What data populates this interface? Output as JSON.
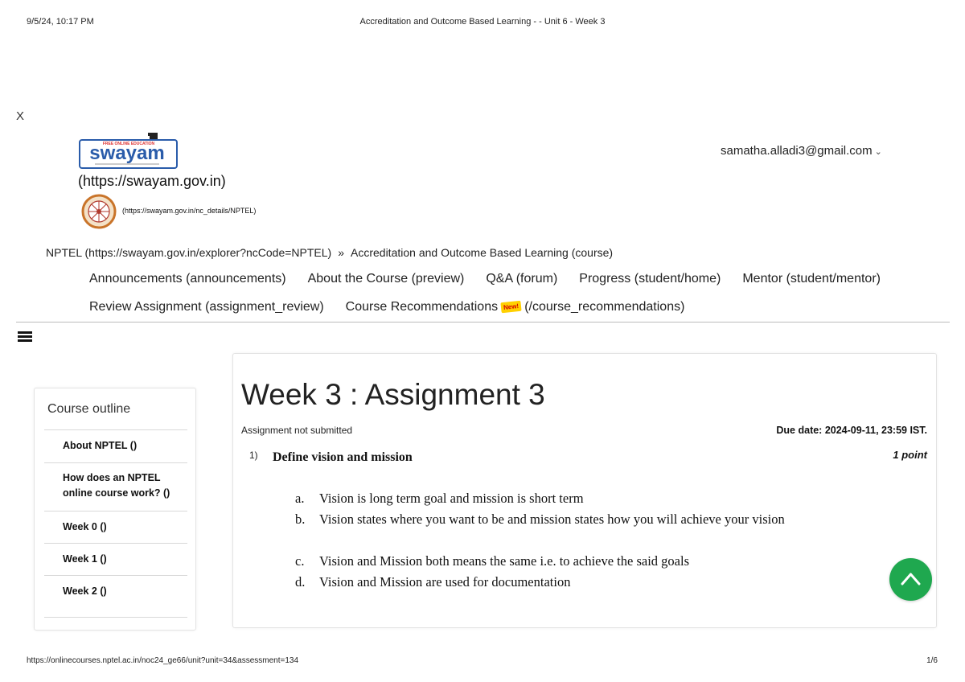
{
  "print_header": {
    "datetime": "9/5/24, 10:17 PM",
    "title": "Accreditation and Outcome Based Learning - - Unit 6 - Week 3"
  },
  "close_label": "X",
  "header": {
    "swayam_logo_text": "swayam",
    "swayam_logo_tagline": "FREE ONLINE EDUCATION",
    "swayam_link": "(https://swayam.gov.in)",
    "nptel_link": "(https://swayam.gov.in/nc_details/NPTEL)",
    "user_email": "samatha.alladi3@gmail.com",
    "user_menu_icon": "chevron-down-icon"
  },
  "breadcrumb": {
    "root": "NPTEL (https://swayam.gov.in/explorer?ncCode=NPTEL)",
    "separator": "»",
    "course": "Accreditation and Outcome Based Learning (course)"
  },
  "nav": {
    "row1": [
      "Announcements (announcements)",
      "About the Course (preview)",
      "Q&A (forum)",
      "Progress (student/home)",
      "Mentor (student/mentor)"
    ],
    "review": "Review Assignment (assignment_review)",
    "recommend": "Course Recommendations",
    "new_badge": "New!",
    "recommend_path": "(/course_recommendations)"
  },
  "menu_icon": "hamburger-menu-icon",
  "outline": {
    "title": "Course outline",
    "items": [
      "About NPTEL ()",
      "How does an NPTEL online course work? ()",
      "Week 0 ()",
      "Week 1 ()",
      "Week 2 ()"
    ]
  },
  "assignment": {
    "title": "Week 3 : Assignment 3",
    "status": "Assignment not submitted",
    "due": "Due date: 2024-09-11, 23:59 IST.",
    "question": {
      "number": "1)",
      "text": "Define vision and mission",
      "points": "1 point",
      "options": [
        {
          "letter": "a.",
          "text": "Vision is long term goal and mission is short term"
        },
        {
          "letter": "b.",
          "text": "Vision states where you want to be and mission states how you will achieve your vision"
        },
        {
          "letter": "c.",
          "text": "Vision and Mission both means the same i.e. to achieve the said goals"
        },
        {
          "letter": "d.",
          "text": "Vision and Mission are used for documentation"
        }
      ]
    }
  },
  "scroll_top_icon": "chevron-up-icon",
  "print_footer": {
    "url": "https://onlinecourses.nptel.ac.in/noc24_ge66/unit?unit=34&assessment=134",
    "page": "1/6"
  },
  "colors": {
    "accent_green": "#1fa84f",
    "swayam_blue": "#2a5caa",
    "new_badge": "#ffd000"
  }
}
